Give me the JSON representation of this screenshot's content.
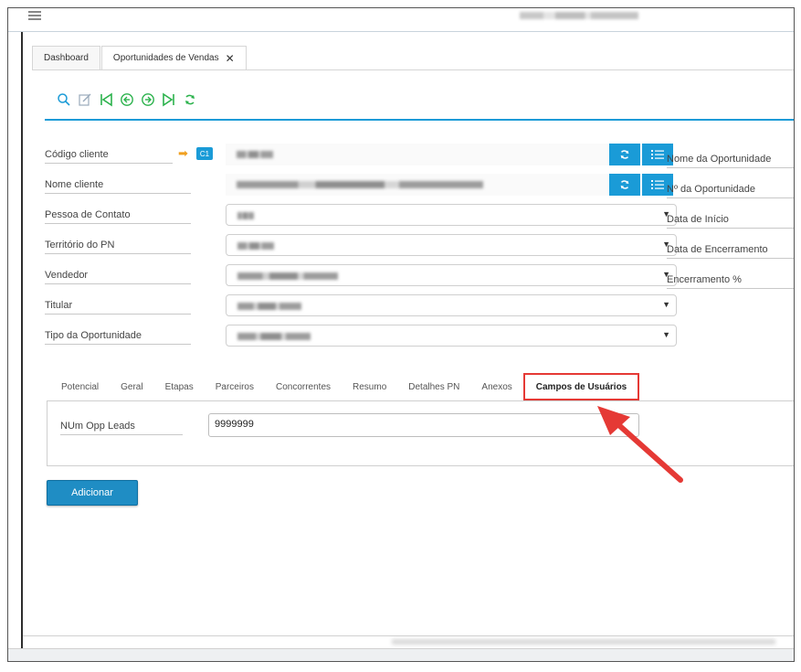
{
  "tabs": [
    {
      "label": "Dashboard"
    },
    {
      "label": "Oportunidades de Vendas",
      "close": "✕"
    }
  ],
  "toolbar": {
    "icons": [
      "search-icon",
      "edit-icon",
      "first-record-icon",
      "previous-record-icon",
      "next-record-icon",
      "last-record-icon",
      "refresh-icon"
    ],
    "accent": "#1a9bd7",
    "icon_color": "#2bb24c"
  },
  "form": {
    "codigo_cliente": {
      "label": "Código cliente",
      "badge": "C1"
    },
    "nome_cliente": {
      "label": "Nome cliente"
    },
    "pessoa_contato": {
      "label": "Pessoa de Contato"
    },
    "territorio": {
      "label": "Território do PN"
    },
    "vendedor": {
      "label": "Vendedor"
    },
    "titular": {
      "label": "Titular"
    },
    "tipo_oportunidade": {
      "label": "Tipo da Oportunidade"
    }
  },
  "right_labels": [
    "Nome da Oportunidade",
    "Nº da Oportunidade",
    "Data de Início",
    "Data de Encerramento",
    "Encerramento %"
  ],
  "subtabs": [
    "Potencial",
    "Geral",
    "Etapas",
    "Parceiros",
    "Concorrentes",
    "Resumo",
    "Detalhes PN",
    "Anexos",
    "Campos de Usuários"
  ],
  "user_fields": {
    "label": "NUm Opp Leads",
    "value": "9999999"
  },
  "add_button": "Adicionar",
  "colors": {
    "primary": "#1a9bd7",
    "highlight_box": "#e53935",
    "annotation_arrow": "#e53935"
  }
}
